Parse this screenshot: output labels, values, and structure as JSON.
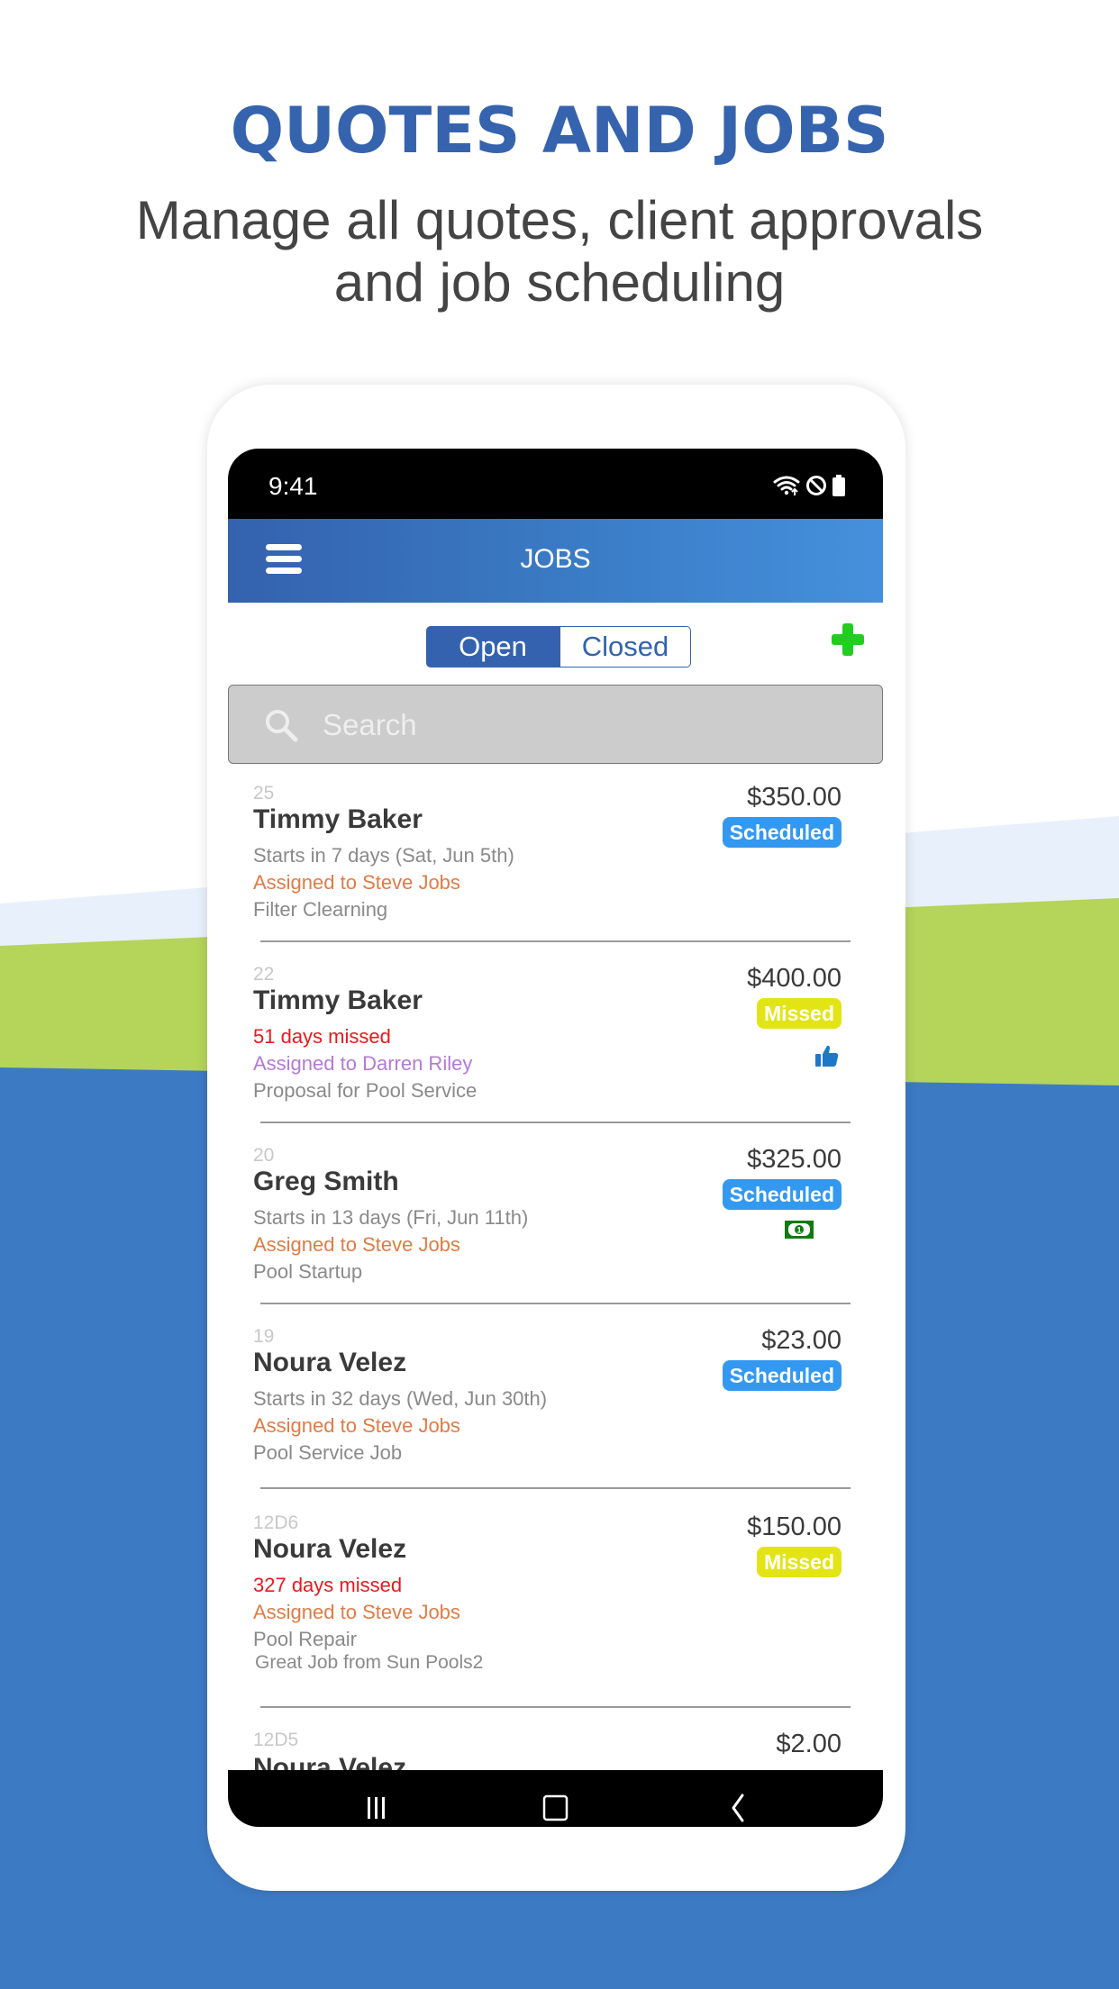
{
  "hero": {
    "title": "QUOTES AND JOBS",
    "subtitle_line1": "Manage all quotes, client approvals",
    "subtitle_line2": "and job scheduling"
  },
  "colors": {
    "brand_blue": "#3563ae",
    "band_light": "#e8f0fb",
    "band_green": "#b4d45a",
    "band_blue": "#3d7ac4",
    "scheduled": "#3399f0",
    "missed": "#e3e416",
    "add_green": "#22cc22"
  },
  "status_bar": {
    "time": "9:41",
    "icons": [
      "wifi-icon",
      "do-not-disturb-icon",
      "battery-icon"
    ]
  },
  "header": {
    "title": "JOBS",
    "menu_icon": "hamburger-menu-icon"
  },
  "segment": {
    "options": [
      "Open",
      "Closed"
    ],
    "selected": "Open"
  },
  "add_icon": "plus-icon",
  "search": {
    "placeholder": "Search",
    "value": ""
  },
  "jobs": [
    {
      "number": "25",
      "name": "Timmy Baker",
      "line1": "Starts in 7 days (Sat, Jun 5th)",
      "line1_style": "gray",
      "assigned": "Assigned to Steve Jobs",
      "assigned_style": "orange",
      "description": "Filter Clearning",
      "price": "$350.00",
      "status": "Scheduled",
      "extra_icon": ""
    },
    {
      "number": "22",
      "name": "Timmy Baker",
      "line1": "51 days missed",
      "line1_style": "red",
      "assigned": "Assigned to Darren Riley",
      "assigned_style": "purple",
      "description": "Proposal for Pool Service",
      "price": "$400.00",
      "status": "Missed",
      "extra_icon": "thumbs-up-icon"
    },
    {
      "number": "20",
      "name": "Greg Smith",
      "line1": "Starts in 13 days (Fri, Jun 11th)",
      "line1_style": "gray",
      "assigned": "Assigned to Steve Jobs",
      "assigned_style": "orange",
      "description": "Pool Startup",
      "price": "$325.00",
      "status": "Scheduled",
      "extra_icon": "money-bill-icon"
    },
    {
      "number": "19",
      "name": "Noura Velez",
      "line1": "Starts in 32 days (Wed, Jun 30th)",
      "line1_style": "gray",
      "assigned": "Assigned to Steve Jobs",
      "assigned_style": "orange",
      "description": "Pool Service Job",
      "price": "$23.00",
      "status": "Scheduled",
      "extra_icon": ""
    },
    {
      "number": "12D6",
      "name": "Noura Velez",
      "line1": "327 days missed",
      "line1_style": "red",
      "assigned": "Assigned to Steve Jobs",
      "assigned_style": "orange",
      "description": "Pool Repair",
      "note": "Great Job from Sun Pools2",
      "price": "$150.00",
      "status": "Missed",
      "extra_icon": ""
    },
    {
      "number": "12D5",
      "name": "Noura Velez",
      "price": "$2.00"
    }
  ],
  "nav_bar": {
    "buttons": [
      "recent-apps-icon",
      "home-icon",
      "back-icon"
    ]
  }
}
